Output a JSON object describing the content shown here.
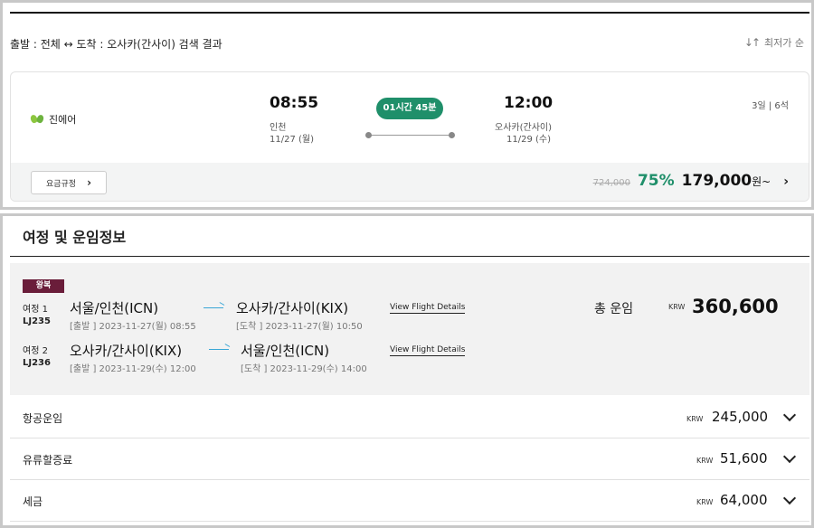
{
  "search": {
    "title": "출발 : 전체 ↔ 도착 : 오사카(간사이) 검색 결과",
    "sort_label": "최저가 순",
    "sort_icon": "sort-arrows-icon"
  },
  "flight": {
    "airline": "진에어",
    "airline_logo": "butterfly-logo-icon",
    "departure": {
      "time": "08:55",
      "city": "인천",
      "date": "11/27 (월)"
    },
    "duration": "01시간 45분",
    "arrival": {
      "time": "12:00",
      "city": "오사카(간사이)",
      "date": "11/29 (수)"
    },
    "stay_info": "3일 | 6석",
    "fare_rule_button": "요금규정",
    "original_price": "724,000",
    "discount": "75%",
    "price": "179,000",
    "price_suffix": "원~"
  },
  "fare_info": {
    "title": "여정 및 운임정보",
    "trip_type": "왕복",
    "legs": [
      {
        "label": "여정 1",
        "flight_no": "LJ235",
        "from": "서울/인천(ICN)",
        "to": "오사카/간사이(KIX)",
        "depart": "[출발 ] 2023-11-27(월) 08:55",
        "arrive": "[도착 ] 2023-11-27(월) 10:50",
        "details_link": "View Flight Details"
      },
      {
        "label": "여정 2",
        "flight_no": "LJ236",
        "from": "오사카/간사이(KIX)",
        "to": "서울/인천(ICN)",
        "depart": "[출발 ] 2023-11-29(수) 12:00",
        "arrive": "[도착 ] 2023-11-29(수) 14:00",
        "details_link": "View Flight Details"
      }
    ],
    "total_label": "총 운임",
    "currency": "KRW",
    "total": "360,600",
    "fees": [
      {
        "label": "항공운임",
        "currency": "KRW",
        "amount": "245,000"
      },
      {
        "label": "유류할증료",
        "currency": "KRW",
        "amount": "51,600"
      },
      {
        "label": "세금",
        "currency": "KRW",
        "amount": "64,000"
      }
    ]
  },
  "colors": {
    "accent_green": "#1f8f6a",
    "badge_maroon": "#6a1d3a",
    "arrow_blue": "#3aa7d6"
  }
}
